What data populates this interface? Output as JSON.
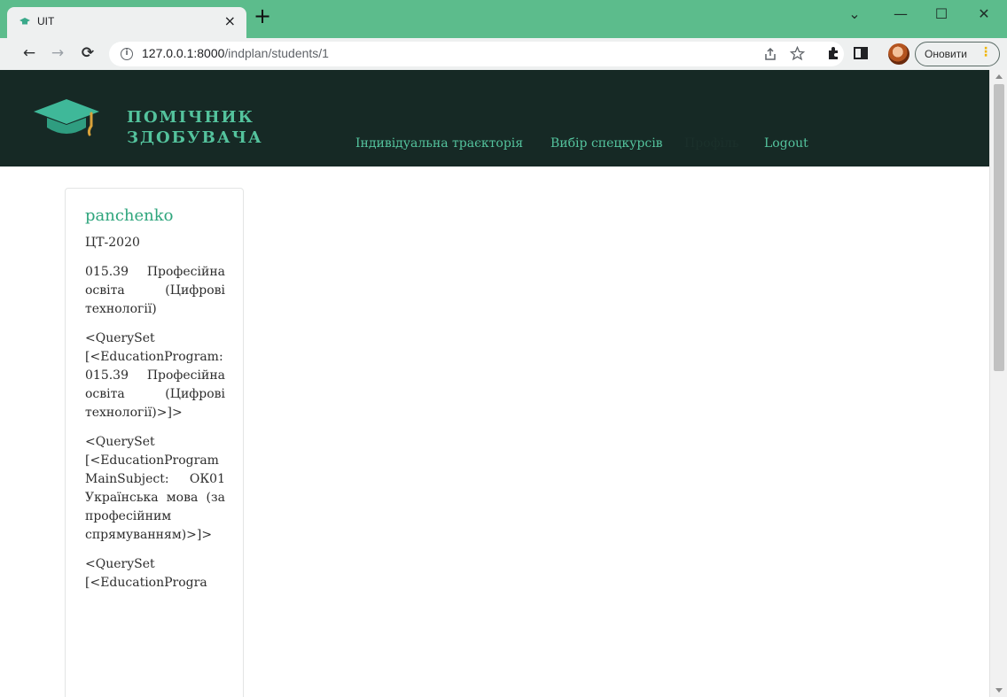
{
  "browser": {
    "tab_title": "UIT",
    "tab_close": "×",
    "new_tab": "+",
    "url_host": "127.0.0.1:8000",
    "url_path": "/indplan/students/1",
    "update_label": "Оновити",
    "update_dots": "⋮",
    "window_controls": {
      "chevron": "⌄",
      "minimize": "—",
      "maximize": "☐",
      "close": "✕"
    },
    "nav": {
      "back": "←",
      "forward": "→",
      "reload": "⟳"
    },
    "colors": {
      "titlebar": "#5cbc8c",
      "toolbar": "#eef0f0"
    }
  },
  "header": {
    "brand_line1": "ПОМІЧНИК",
    "brand_line2": "ЗДОБУВАЧА",
    "nav": [
      {
        "label": "Індивідуальна траєкторія"
      },
      {
        "label": "Вибір спецкурсів"
      },
      {
        "label": "Профіль"
      },
      {
        "label": "Logout"
      }
    ],
    "colors": {
      "background": "#162925",
      "accent": "#54c39d"
    }
  },
  "student_card": {
    "username": "panchenko",
    "group": "ЦТ-2020",
    "program": "015.39 Професійна освіта (Цифрові технології)",
    "queryset_program": "<QuerySet [<EducationProgram: 015.39 Професійна освіта (Цифрові технології)>]>",
    "queryset_subject": "<QuerySet [<EducationProgramMainSubject: ОК01 Українська мова (за професійним спрямуванням)>]>",
    "queryset_partial": "<QuerySet [<EducationProgra"
  }
}
